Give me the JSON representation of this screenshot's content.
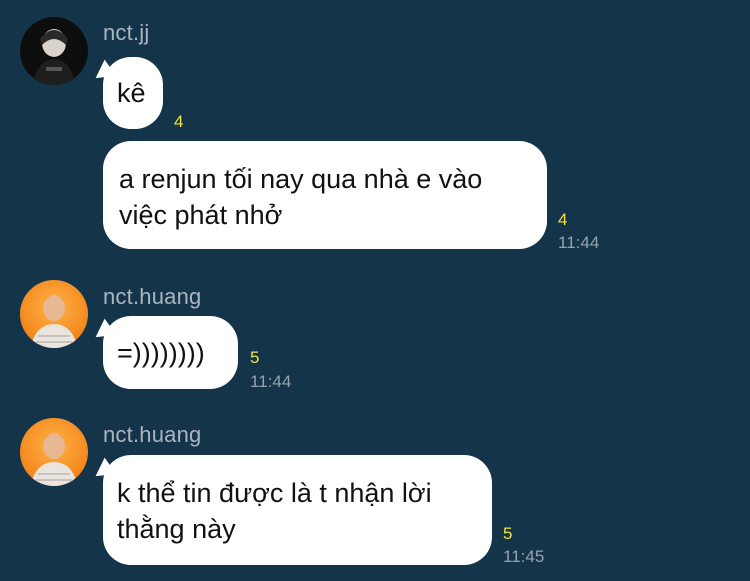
{
  "chat": {
    "background": "#143449",
    "messages": [
      {
        "sender": "nct.jj",
        "avatar": "dark-portrait",
        "text": "kê",
        "read_count": "4",
        "time": ""
      },
      {
        "sender": "",
        "avatar": "",
        "text_lines": [
          "a renjun tối nay qua nhà e vào",
          "việc phát nhở"
        ],
        "read_count": "4",
        "time": "11:44"
      },
      {
        "sender": "nct.huang",
        "avatar": "orange-portrait",
        "text": "=))))))))",
        "read_count": "5",
        "time": "11:44"
      },
      {
        "sender": "nct.huang",
        "avatar": "orange-portrait",
        "text_lines": [
          "k thể tin được là t nhận lời",
          "thằng này"
        ],
        "read_count": "5",
        "time": "11:45"
      }
    ]
  }
}
